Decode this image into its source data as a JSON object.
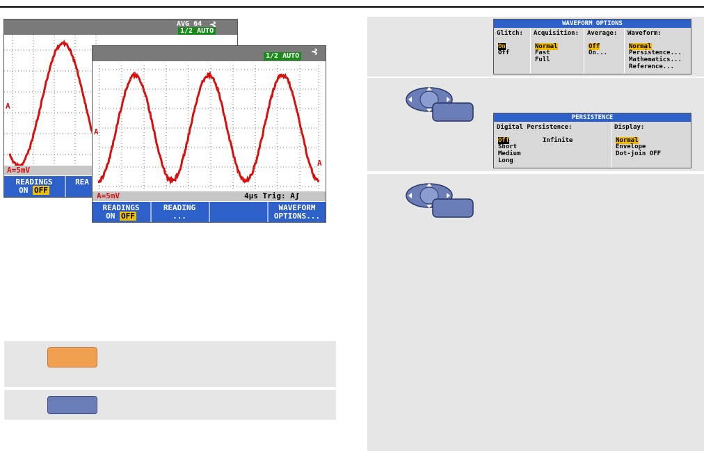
{
  "scope_back": {
    "badge_top": "AVG 64",
    "badge_mode": "1/2 AUTO",
    "marker": "A",
    "status_left": "A=5mV",
    "softkey_readings": "READINGS",
    "softkey_on": "ON",
    "softkey_off": "OFF",
    "softkey_reading_partial": "REA"
  },
  "scope_front": {
    "badge_mode": "1/2 AUTO",
    "marker": "A",
    "status_left": "A=5mV",
    "status_right": "4µs Trig: Aʃ",
    "softkeys": {
      "readings": "READINGS",
      "on": "ON",
      "off": "OFF",
      "reading": "READING",
      "reading_sub": "...",
      "waveform": "WAVEFORM",
      "options": "OPTIONS..."
    }
  },
  "waveform_options_menu": {
    "title": "WAVEFORM OPTIONS",
    "glitch": {
      "header": "Glitch:",
      "items": [
        "On",
        "Off"
      ],
      "selected": "On"
    },
    "acquisition": {
      "header": "Acquisition:",
      "items": [
        "Normal",
        "Fast",
        "Full"
      ],
      "selected": "Normal"
    },
    "average": {
      "header": "Average:",
      "items": [
        "Off",
        "On..."
      ],
      "selected": "Off"
    },
    "waveform": {
      "header": "Waveform:",
      "items": [
        "Normal",
        "Persistence...",
        "Mathematics...",
        "Reference..."
      ],
      "selected": "Normal"
    }
  },
  "persistence_menu": {
    "title": "PERSISTENCE",
    "digital": {
      "header": "Digital Persistence:",
      "items": [
        "Off",
        "Short",
        "Medium",
        "Long"
      ],
      "selected": "Off",
      "extra": "Infinite"
    },
    "display": {
      "header": "Display:",
      "items": [
        "Normal",
        "Envelope",
        "Dot-join OFF"
      ],
      "selected": "Normal"
    }
  },
  "colors": {
    "waveform": "#d81010",
    "softkey_bar": "#2d60c8",
    "orange_key": "#f0a050",
    "blue_key": "#6b7db6",
    "row_gray": "#e6e6e6"
  },
  "icons": [
    "arrow-keypad-icon",
    "enter-key-icon"
  ]
}
